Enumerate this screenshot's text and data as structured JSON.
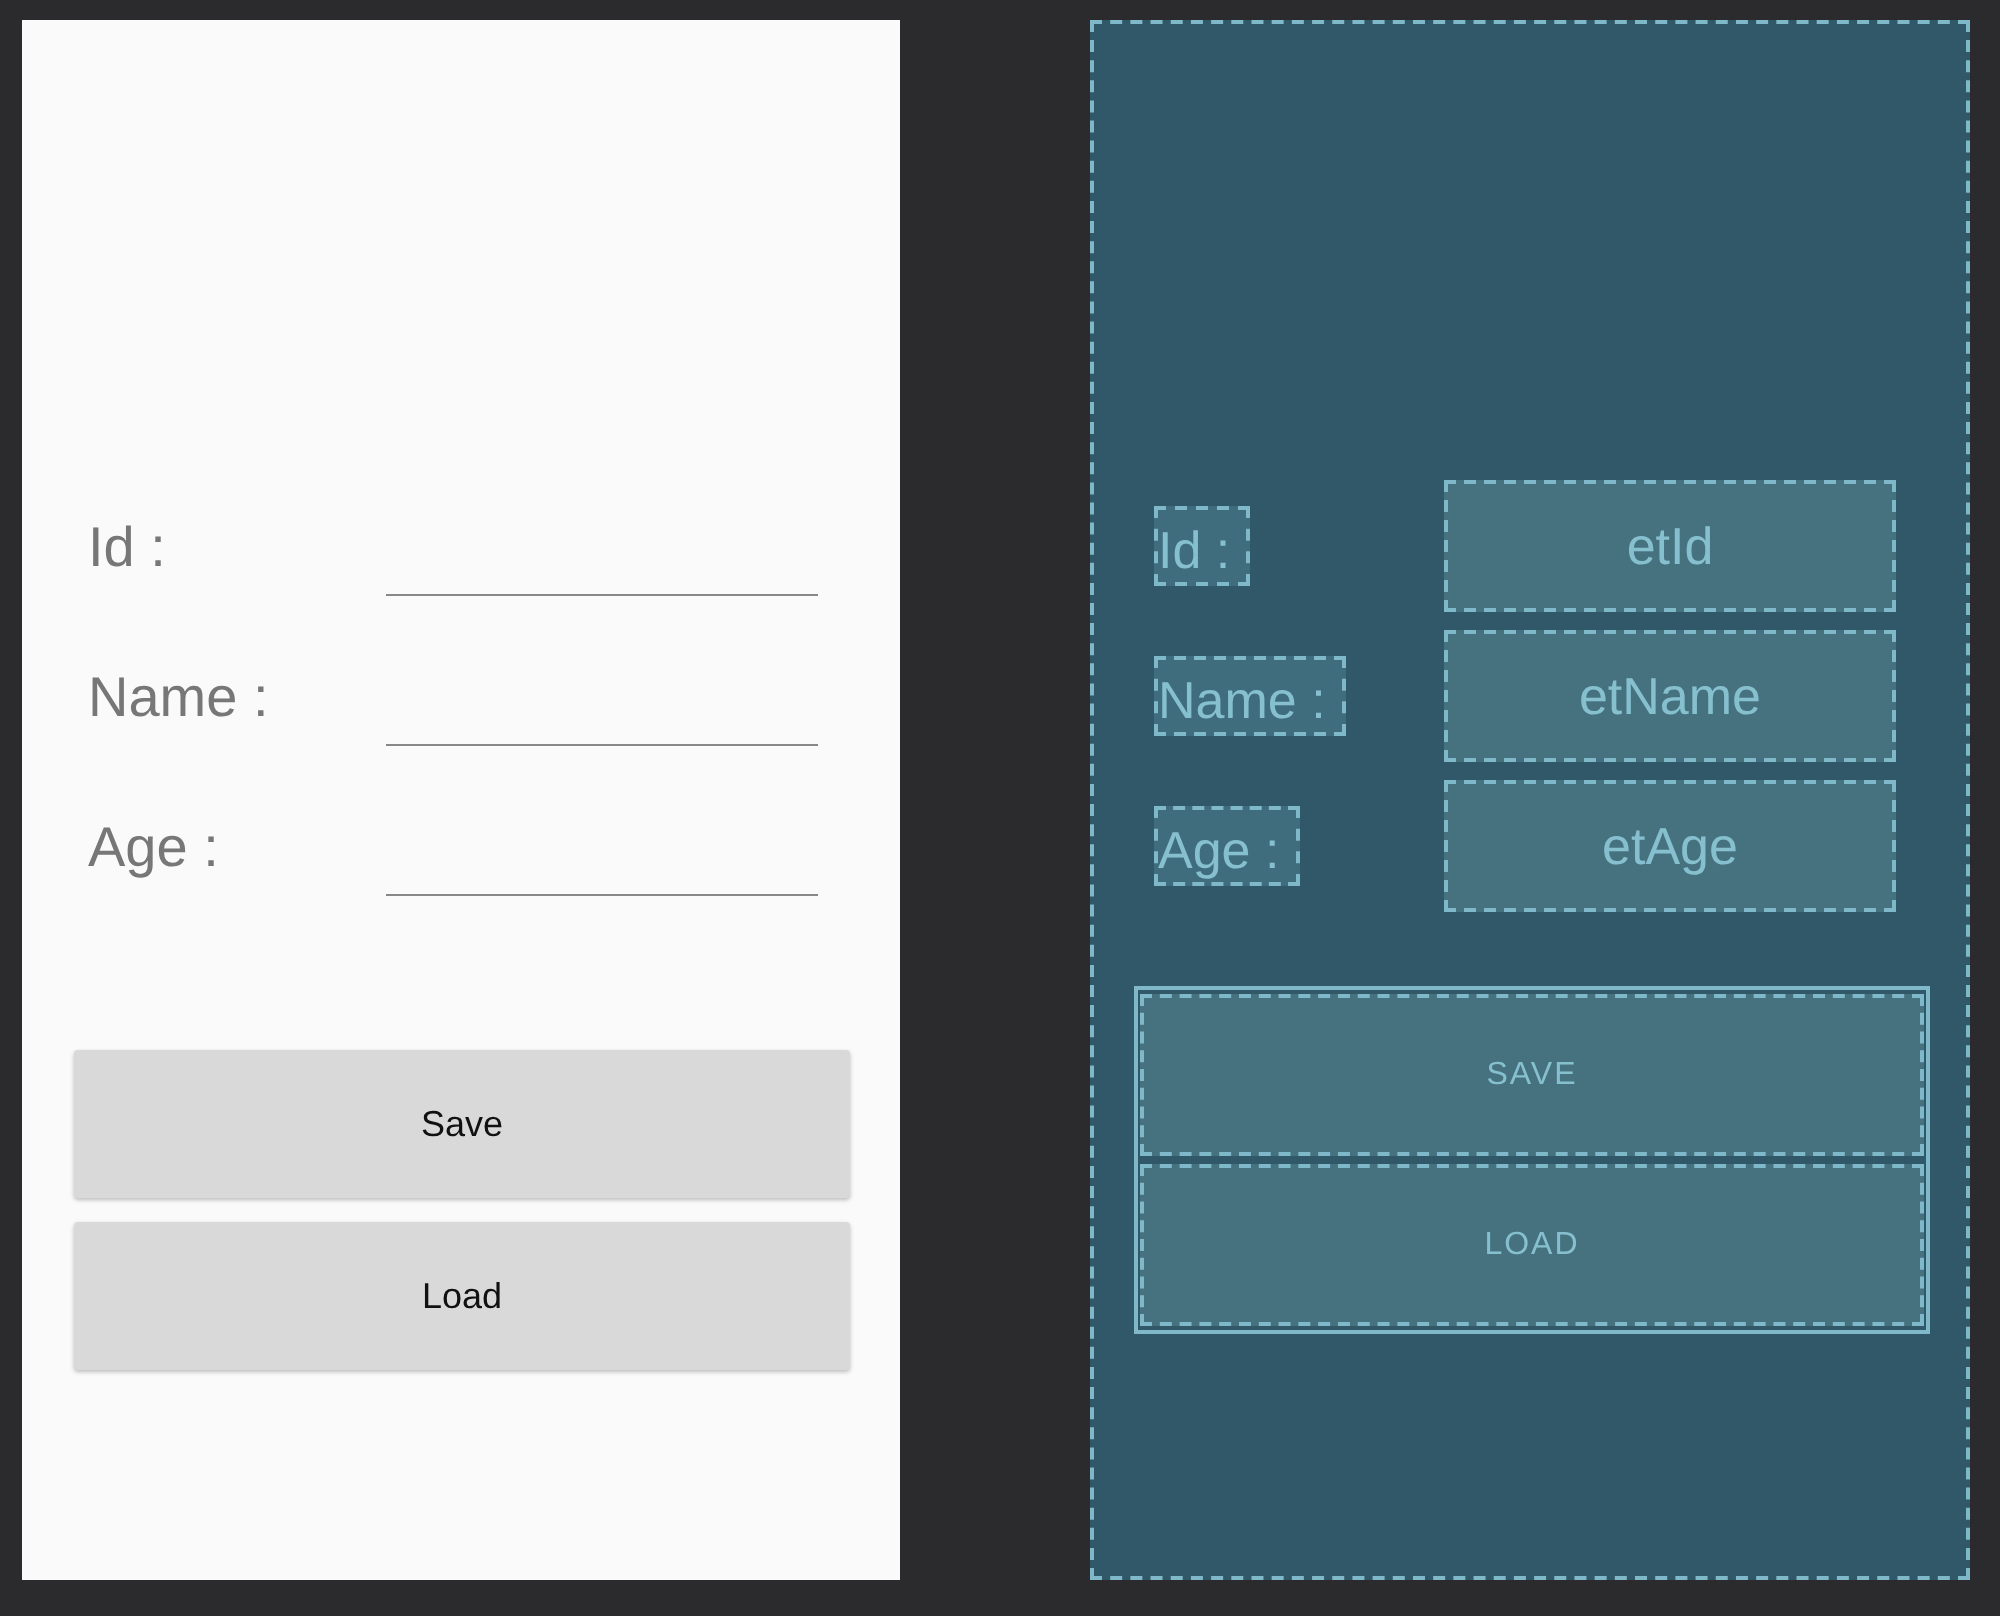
{
  "design": {
    "fields": [
      {
        "label": "Id :"
      },
      {
        "label": "Name :"
      },
      {
        "label": "Age :"
      }
    ],
    "buttons": [
      "Save",
      "Load"
    ]
  },
  "blueprint": {
    "fields": [
      {
        "label": "Id :",
        "field_text": "etId"
      },
      {
        "label": "Name :",
        "field_text": "etName"
      },
      {
        "label": "Age :",
        "field_text": "etAge"
      }
    ],
    "buttons": [
      "SAVE",
      "LOAD"
    ]
  }
}
